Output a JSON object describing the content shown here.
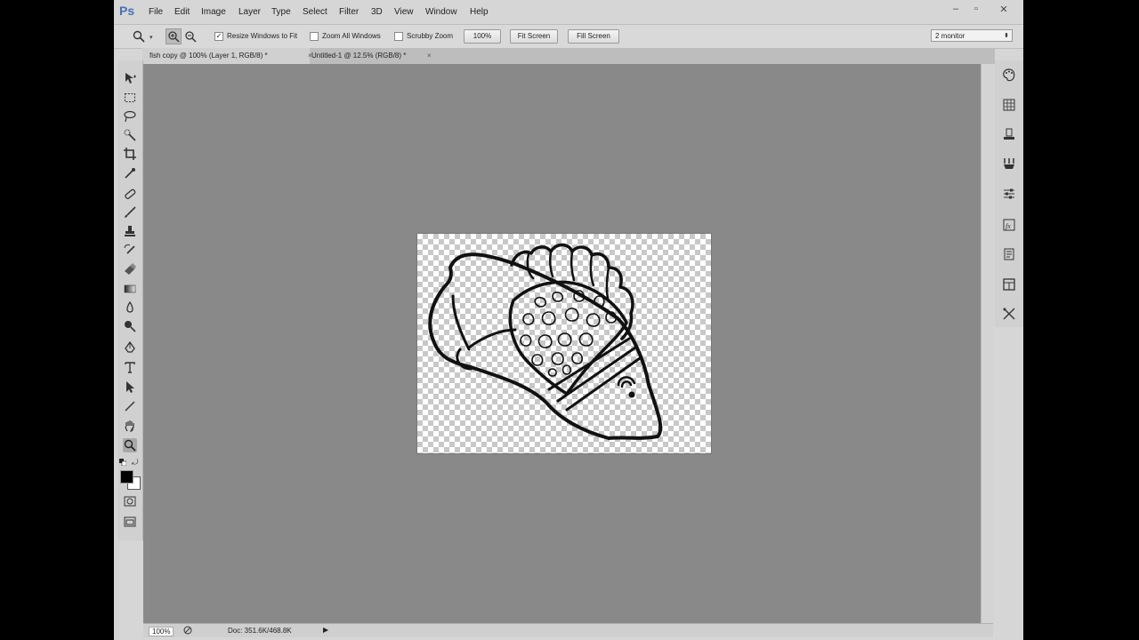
{
  "app": {
    "logo": "Ps"
  },
  "menu": [
    "File",
    "Edit",
    "Image",
    "Layer",
    "Type",
    "Select",
    "Filter",
    "3D",
    "View",
    "Window",
    "Help"
  ],
  "window_controls": {
    "minimize": "–",
    "maximize": "▫",
    "close": "✕"
  },
  "options": {
    "resize_windows": {
      "label": "Resize Windows to Fit",
      "checked": true
    },
    "zoom_all": {
      "label": "Zoom All Windows",
      "checked": false
    },
    "scrubby_zoom": {
      "label": "Scrubby Zoom",
      "checked": false
    },
    "zoom_value": "100%",
    "fit_screen": "Fit Screen",
    "fill_screen": "Fill Screen",
    "workspace": "2 monitor"
  },
  "tabs": [
    {
      "label": "fish copy @ 100% (Layer 1, RGB/8) *",
      "close": "×"
    },
    {
      "label": "Untitled-1 @ 12.5% (RGB/8) *",
      "close": "×"
    }
  ],
  "status": {
    "zoom": "100%",
    "doc": "Doc: 351.6K/468.8K",
    "arrow": "▶"
  },
  "colors": {
    "ps_blue": "#4a6fb5",
    "canvas_bg": "#898989",
    "foreground": "#000000",
    "background": "#ffffff"
  }
}
